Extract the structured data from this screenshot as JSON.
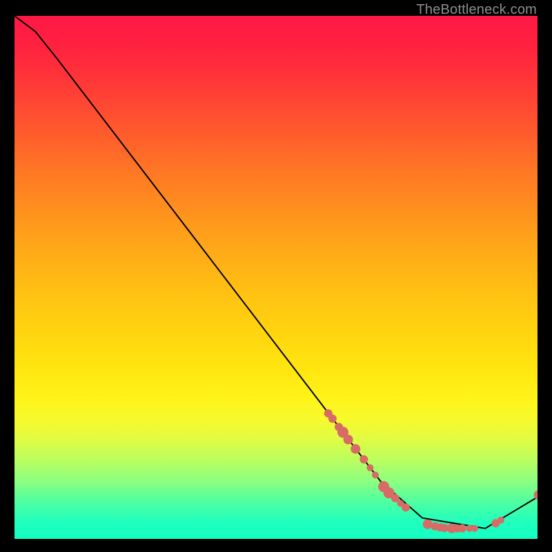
{
  "watermark": "TheBottleneck.com",
  "chart_data": {
    "type": "line",
    "title": "",
    "xlabel": "",
    "ylabel": "",
    "xlim": [
      0,
      100
    ],
    "ylim": [
      0,
      100
    ],
    "series": [
      {
        "name": "curve",
        "x": [
          0,
          4,
          8,
          70,
          78,
          90,
          100
        ],
        "y": [
          100,
          97,
          92,
          11,
          4,
          2,
          8
        ],
        "color": "#000000"
      }
    ],
    "markers": [
      {
        "name": "points",
        "color": "#d86b66",
        "radius_min": 5,
        "radius_max": 8,
        "points": [
          {
            "x": 60.0,
            "y": 24.0,
            "r": 6
          },
          {
            "x": 60.8,
            "y": 23.0,
            "r": 6
          },
          {
            "x": 62.0,
            "y": 21.4,
            "r": 6
          },
          {
            "x": 62.8,
            "y": 20.4,
            "r": 8
          },
          {
            "x": 63.8,
            "y": 19.0,
            "r": 7
          },
          {
            "x": 65.2,
            "y": 17.2,
            "r": 7
          },
          {
            "x": 66.8,
            "y": 15.2,
            "r": 6
          },
          {
            "x": 68.0,
            "y": 13.6,
            "r": 5
          },
          {
            "x": 69.0,
            "y": 12.2,
            "r": 5
          },
          {
            "x": 70.6,
            "y": 10.0,
            "r": 8
          },
          {
            "x": 71.6,
            "y": 8.8,
            "r": 8
          },
          {
            "x": 72.8,
            "y": 7.8,
            "r": 6
          },
          {
            "x": 73.8,
            "y": 6.8,
            "r": 5
          },
          {
            "x": 74.8,
            "y": 6.0,
            "r": 6
          },
          {
            "x": 79.0,
            "y": 2.8,
            "r": 7
          },
          {
            "x": 80.4,
            "y": 2.4,
            "r": 6
          },
          {
            "x": 81.4,
            "y": 2.2,
            "r": 6
          },
          {
            "x": 82.2,
            "y": 2.1,
            "r": 6
          },
          {
            "x": 83.6,
            "y": 2.0,
            "r": 7
          },
          {
            "x": 84.6,
            "y": 2.0,
            "r": 6
          },
          {
            "x": 85.6,
            "y": 2.0,
            "r": 6
          },
          {
            "x": 87.0,
            "y": 2.0,
            "r": 5
          },
          {
            "x": 88.0,
            "y": 2.0,
            "r": 5
          },
          {
            "x": 92.0,
            "y": 3.0,
            "r": 6
          },
          {
            "x": 93.0,
            "y": 3.6,
            "r": 5
          },
          {
            "x": 100.2,
            "y": 8.4,
            "r": 7
          }
        ]
      }
    ]
  }
}
